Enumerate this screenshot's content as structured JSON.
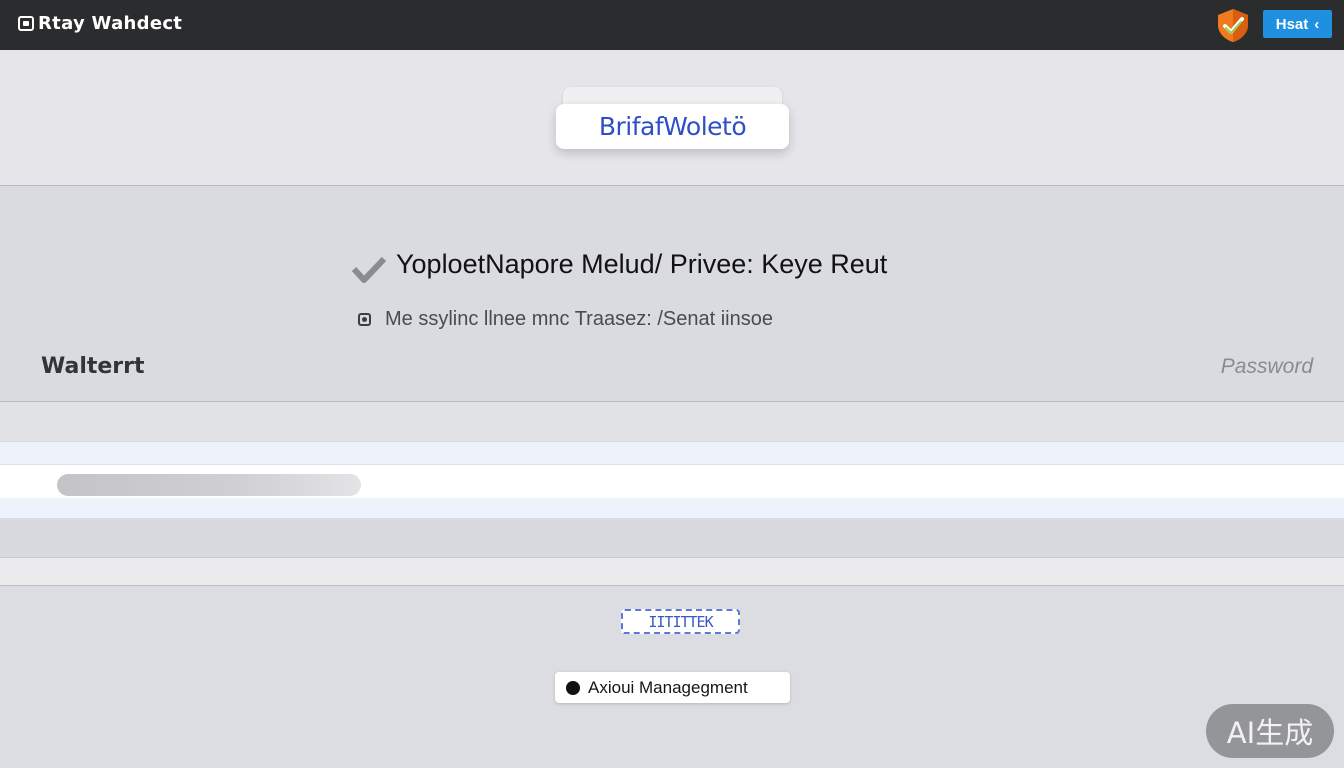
{
  "app": {
    "title": "Rtay Wahdect"
  },
  "topbar": {
    "button_label": "Hsat",
    "button_chevron": "‹",
    "shield_icon": "shield-check-icon",
    "accent_color": "#1f8fe0",
    "shield_color": "#f07a1c"
  },
  "header": {
    "logo_text": "BrifafWoletö"
  },
  "main": {
    "headline": "YoploetNapore Melud/ Privee: Keye Reut",
    "subline": "Me ssylinc  llnee mnc   Traasez: /Senat iinsoe",
    "left_label": "Walterrt",
    "right_label": "Password"
  },
  "progress": {
    "fill_fraction": 1.0
  },
  "footer": {
    "small_badge_text": "IITITTEK",
    "management_label": "Axioui  Managegment"
  },
  "watermark": {
    "text": "AI生成"
  }
}
